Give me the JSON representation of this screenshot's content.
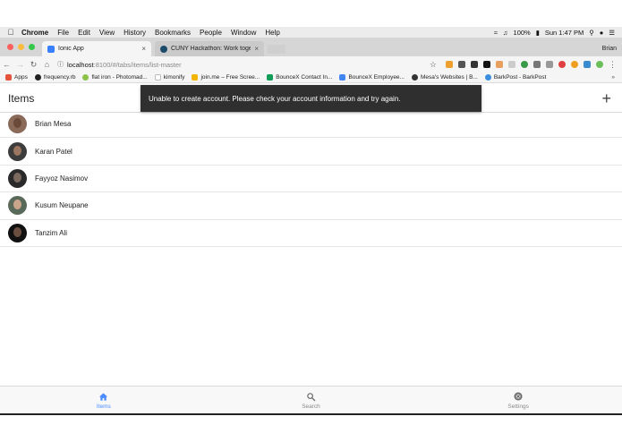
{
  "menubar": {
    "apple": "",
    "items": [
      "Chrome",
      "File",
      "Edit",
      "View",
      "History",
      "Bookmarks",
      "People",
      "Window",
      "Help"
    ],
    "battery": "100%",
    "clock": "Sun 1:47 PM"
  },
  "tabs": [
    {
      "label": "Ionic App",
      "close": "×",
      "active": true
    },
    {
      "label": "CUNY Hackathon: Work togeth",
      "close": "×",
      "active": false
    }
  ],
  "profile_name": "Brian",
  "address": {
    "host": "localhost",
    "path": ":8100/#/tabs/items/list-master"
  },
  "bookmarks": [
    {
      "label": "Apps",
      "color": "#e5533d"
    },
    {
      "label": "frequency.rb",
      "color": "#222222"
    },
    {
      "label": "flat iron - Photomad...",
      "color": "#8bc34a"
    },
    {
      "label": "kimonify",
      "color": "#bdbdbd"
    },
    {
      "label": "join.me – Free Scree...",
      "color": "#f4b400"
    },
    {
      "label": "BounceX Contact In...",
      "color": "#0f9d58"
    },
    {
      "label": "BounceX Employee...",
      "color": "#4285f4"
    },
    {
      "label": "Mesa's Websites | B...",
      "color": "#333333"
    },
    {
      "label": "BarkPost - BarkPost",
      "color": "#3b8de0"
    }
  ],
  "bookmarks_more": "»",
  "page": {
    "title": "Items",
    "add_label": "+",
    "toast": "Unable to create account. Please check your account information and try again."
  },
  "items": [
    {
      "name": "Brian Mesa",
      "skin": "#6b4a3a",
      "bg": "#8a6b5a"
    },
    {
      "name": "Karan Patel",
      "skin": "#9a7560",
      "bg": "#3c3c3c"
    },
    {
      "name": "Fayyoz Nasimov",
      "skin": "#7a6a60",
      "bg": "#2a2a2a"
    },
    {
      "name": "Kusum Neupane",
      "skin": "#c9a58c",
      "bg": "#5a6a5a"
    },
    {
      "name": "Tanzim Ali",
      "skin": "#6a4e40",
      "bg": "#111111"
    }
  ],
  "bottom_tabs": [
    {
      "label": "Items",
      "icon": "home-icon",
      "selected": true
    },
    {
      "label": "Search",
      "icon": "search-icon",
      "selected": false
    },
    {
      "label": "Settings",
      "icon": "settings-icon",
      "selected": false
    }
  ],
  "colors": {
    "accent": "#488aff",
    "toast_bg": "#2f2f2f"
  }
}
